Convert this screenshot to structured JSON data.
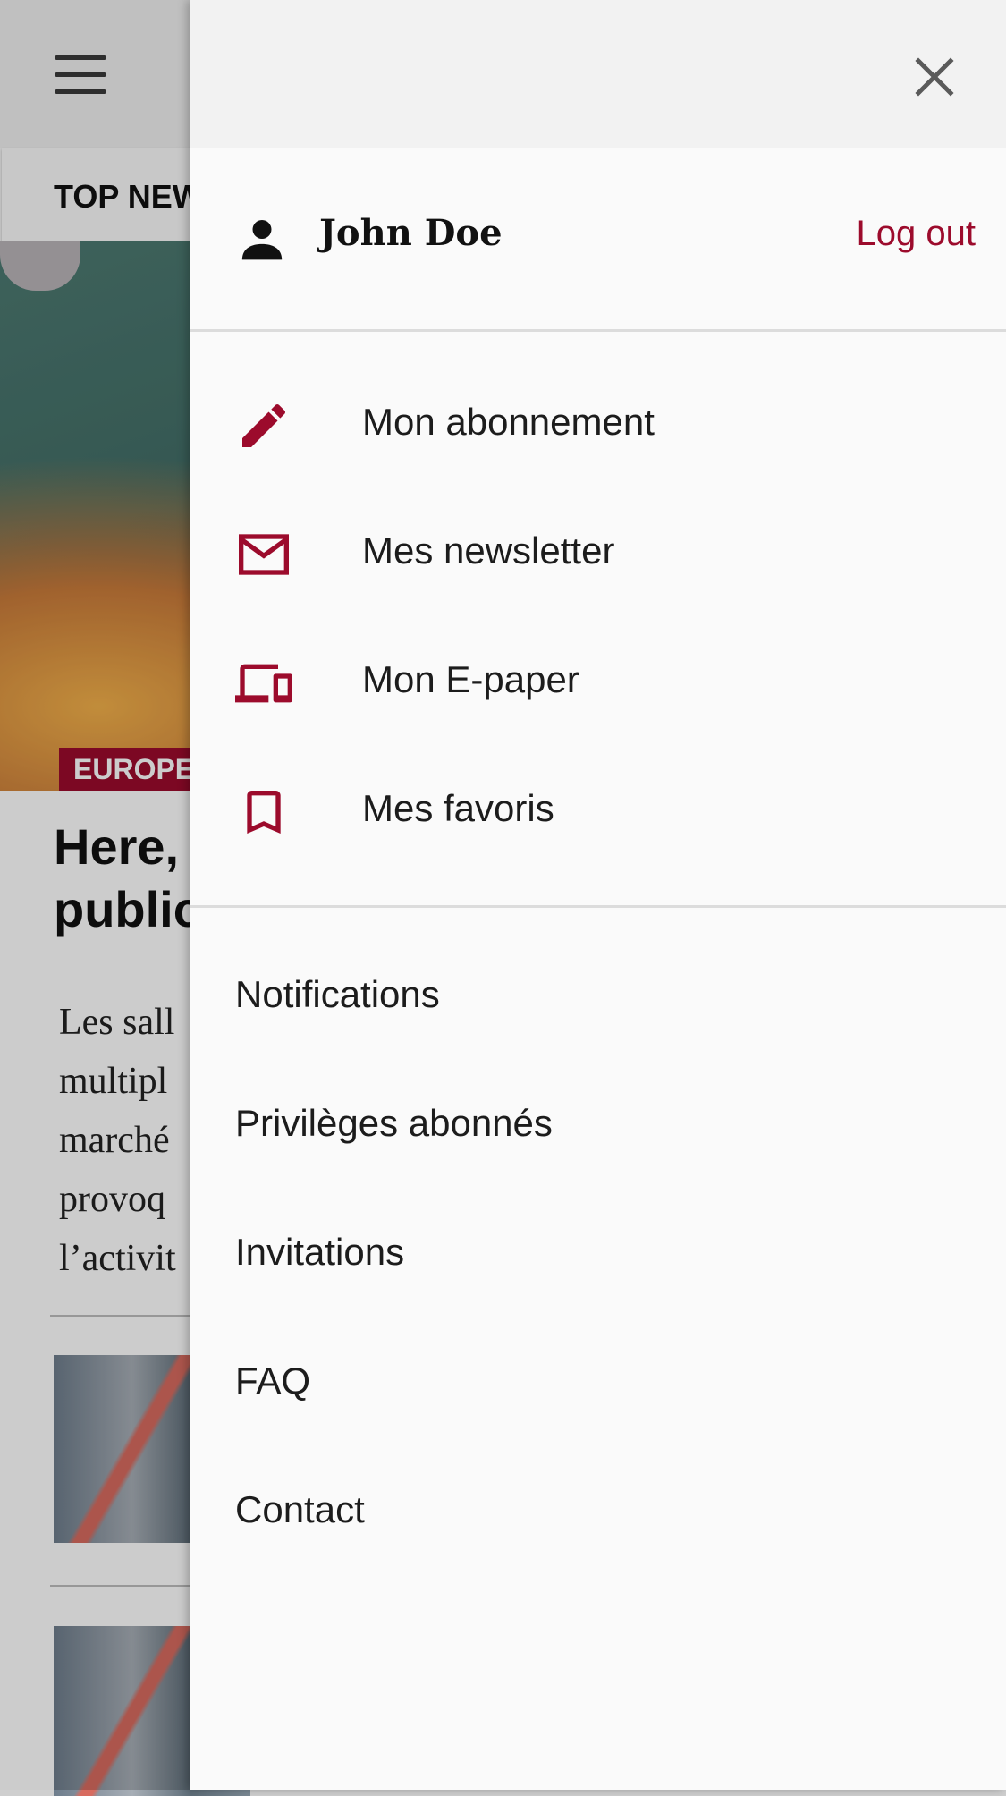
{
  "colors": {
    "accent": "#9c0b2c",
    "drawer_bg": "#fafafa",
    "drawer_header_bg": "#f2f2f2"
  },
  "background": {
    "tab_label": "TOP NEWS",
    "badge": "EUROPE",
    "article_title_lines": [
      "Here,",
      "public"
    ],
    "article_lede_lines": [
      "Les sall",
      "multipl",
      "marché",
      "provoq",
      "l’activit"
    ]
  },
  "drawer": {
    "close_icon": "close-icon",
    "user": {
      "icon": "person-icon",
      "name": "John Doe",
      "logout_label": "Log out"
    },
    "account_items": [
      {
        "icon": "pencil-icon",
        "label": "Mon abonnement"
      },
      {
        "icon": "envelope-icon",
        "label": "Mes newsletter"
      },
      {
        "icon": "devices-icon",
        "label": "Mon E-paper"
      },
      {
        "icon": "bookmark-icon",
        "label": "Mes favoris"
      }
    ],
    "links": [
      {
        "label": "Notifications"
      },
      {
        "label": "Privilèges abonnés"
      },
      {
        "label": "Invitations"
      },
      {
        "label": "FAQ"
      },
      {
        "label": "Contact"
      }
    ]
  }
}
